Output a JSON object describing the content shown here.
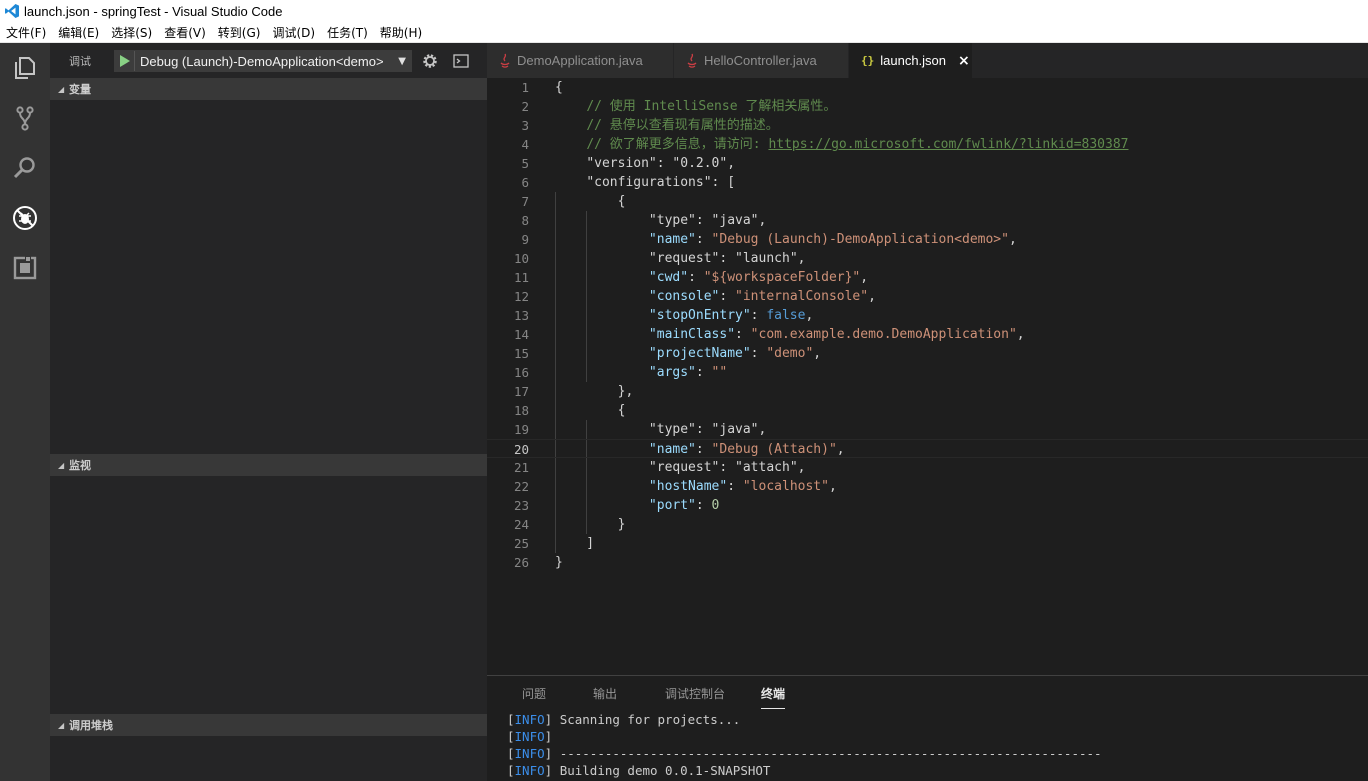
{
  "window": {
    "title": "launch.json - springTest - Visual Studio Code"
  },
  "menu": [
    "文件(F)",
    "编辑(E)",
    "选择(S)",
    "查看(V)",
    "转到(G)",
    "调试(D)",
    "任务(T)",
    "帮助(H)"
  ],
  "activity_bar": [
    "files-icon",
    "source-control-icon",
    "search-icon",
    "debug-icon",
    "extensions-icon"
  ],
  "sidebar": {
    "title": "调试",
    "debug_config": "Debug (Launch)-DemoApplication<demo>",
    "sections": {
      "variables": "变量",
      "watch": "监视",
      "call_stack": "调用堆栈"
    }
  },
  "tabs": [
    {
      "label": "DemoApplication.java",
      "icon": "java-file-icon"
    },
    {
      "label": "HelloController.java",
      "icon": "java-file-icon"
    },
    {
      "label": "launch.json",
      "icon": "json-file-icon",
      "json_glyph": "{}",
      "close": "×"
    }
  ],
  "editor": {
    "current_line": 20,
    "lines": [
      {
        "n": "1",
        "segs": [
          [
            "p",
            "{"
          ]
        ]
      },
      {
        "n": "2",
        "segs": [
          [
            "p",
            "    "
          ],
          [
            "c",
            "// 使用 IntelliSense 了解相关属性。"
          ]
        ]
      },
      {
        "n": "3",
        "segs": [
          [
            "p",
            "    "
          ],
          [
            "c",
            "// 悬停以查看现有属性的描述。"
          ]
        ]
      },
      {
        "n": "4",
        "segs": [
          [
            "p",
            "    "
          ],
          [
            "c",
            "// 欲了解更多信息，请访问: "
          ],
          [
            "l",
            "https://go.microsoft.com/fwlink/?linkid=830387"
          ]
        ]
      },
      {
        "n": "5",
        "segs": [
          [
            "p",
            "    "
          ],
          [
            "k",
            "\"version\""
          ],
          [
            "p",
            ": "
          ],
          [
            "k",
            "\"0.2.0\""
          ],
          [
            "p",
            ","
          ]
        ]
      },
      {
        "n": "6",
        "segs": [
          [
            "p",
            "    "
          ],
          [
            "k",
            "\"configurations\""
          ],
          [
            "p",
            ": ["
          ]
        ]
      },
      {
        "n": "7",
        "segs": [
          [
            "p",
            "        {"
          ]
        ]
      },
      {
        "n": "8",
        "segs": [
          [
            "p",
            "            "
          ],
          [
            "k",
            "\"type\""
          ],
          [
            "p",
            ": "
          ],
          [
            "k",
            "\"java\""
          ],
          [
            "p",
            ","
          ]
        ]
      },
      {
        "n": "9",
        "segs": [
          [
            "p",
            "            "
          ],
          [
            "a",
            "\"name\""
          ],
          [
            "p",
            ": "
          ],
          [
            "s",
            "\"Debug (Launch)-DemoApplication<demo>\""
          ],
          [
            "p",
            ","
          ]
        ]
      },
      {
        "n": "10",
        "segs": [
          [
            "p",
            "            "
          ],
          [
            "k",
            "\"request\""
          ],
          [
            "p",
            ": "
          ],
          [
            "k",
            "\"launch\""
          ],
          [
            "p",
            ","
          ]
        ]
      },
      {
        "n": "11",
        "segs": [
          [
            "p",
            "            "
          ],
          [
            "a",
            "\"cwd\""
          ],
          [
            "p",
            ": "
          ],
          [
            "s",
            "\"${workspaceFolder}\""
          ],
          [
            "p",
            ","
          ]
        ]
      },
      {
        "n": "12",
        "segs": [
          [
            "p",
            "            "
          ],
          [
            "a",
            "\"console\""
          ],
          [
            "p",
            ": "
          ],
          [
            "s",
            "\"internalConsole\""
          ],
          [
            "p",
            ","
          ]
        ]
      },
      {
        "n": "13",
        "segs": [
          [
            "p",
            "            "
          ],
          [
            "a",
            "\"stopOnEntry\""
          ],
          [
            "p",
            ": "
          ],
          [
            "b",
            "false"
          ],
          [
            "p",
            ","
          ]
        ]
      },
      {
        "n": "14",
        "segs": [
          [
            "p",
            "            "
          ],
          [
            "a",
            "\"mainClass\""
          ],
          [
            "p",
            ": "
          ],
          [
            "s",
            "\"com.example.demo.DemoApplication\""
          ],
          [
            "p",
            ","
          ]
        ]
      },
      {
        "n": "15",
        "segs": [
          [
            "p",
            "            "
          ],
          [
            "a",
            "\"projectName\""
          ],
          [
            "p",
            ": "
          ],
          [
            "s",
            "\"demo\""
          ],
          [
            "p",
            ","
          ]
        ]
      },
      {
        "n": "16",
        "segs": [
          [
            "p",
            "            "
          ],
          [
            "a",
            "\"args\""
          ],
          [
            "p",
            ": "
          ],
          [
            "s",
            "\"\""
          ]
        ]
      },
      {
        "n": "17",
        "segs": [
          [
            "p",
            "        },"
          ]
        ]
      },
      {
        "n": "18",
        "segs": [
          [
            "p",
            "        {"
          ]
        ]
      },
      {
        "n": "19",
        "segs": [
          [
            "p",
            "            "
          ],
          [
            "k",
            "\"type\""
          ],
          [
            "p",
            ": "
          ],
          [
            "k",
            "\"java\""
          ],
          [
            "p",
            ","
          ]
        ]
      },
      {
        "n": "20",
        "segs": [
          [
            "p",
            "            "
          ],
          [
            "a",
            "\"name\""
          ],
          [
            "p",
            ": "
          ],
          [
            "s",
            "\"Debug (Attach)\""
          ],
          [
            "p",
            ","
          ]
        ]
      },
      {
        "n": "21",
        "segs": [
          [
            "p",
            "            "
          ],
          [
            "k",
            "\"request\""
          ],
          [
            "p",
            ": "
          ],
          [
            "k",
            "\"attach\""
          ],
          [
            "p",
            ","
          ]
        ]
      },
      {
        "n": "22",
        "segs": [
          [
            "p",
            "            "
          ],
          [
            "a",
            "\"hostName\""
          ],
          [
            "p",
            ": "
          ],
          [
            "s",
            "\"localhost\""
          ],
          [
            "p",
            ","
          ]
        ]
      },
      {
        "n": "23",
        "segs": [
          [
            "p",
            "            "
          ],
          [
            "a",
            "\"port\""
          ],
          [
            "p",
            ": "
          ],
          [
            "n",
            "0"
          ]
        ]
      },
      {
        "n": "24",
        "segs": [
          [
            "p",
            "        }"
          ]
        ]
      },
      {
        "n": "25",
        "segs": [
          [
            "p",
            "    ]"
          ]
        ]
      },
      {
        "n": "26",
        "segs": [
          [
            "p",
            "}"
          ]
        ]
      }
    ]
  },
  "panel": {
    "tabs": [
      "问题",
      "输出",
      "调试控制台",
      "终端"
    ],
    "active_tab": "终端",
    "terminal": [
      {
        "tag": "INFO",
        "text": " Scanning for projects..."
      },
      {
        "tag": "INFO",
        "text": ""
      },
      {
        "tag": "INFO",
        "text": " ------------------------------------------------------------------------"
      },
      {
        "tag": "INFO",
        "text": " Building demo 0.0.1-SNAPSHOT"
      }
    ]
  },
  "colors": {
    "activity_bar": "#333333",
    "sidebar": "#252526",
    "editor": "#1e1e1e",
    "comment": "#608b4e",
    "property": "#9cdcfe",
    "string": "#ce9178",
    "keyword": "#569cd6",
    "info": "#3b8eea"
  }
}
